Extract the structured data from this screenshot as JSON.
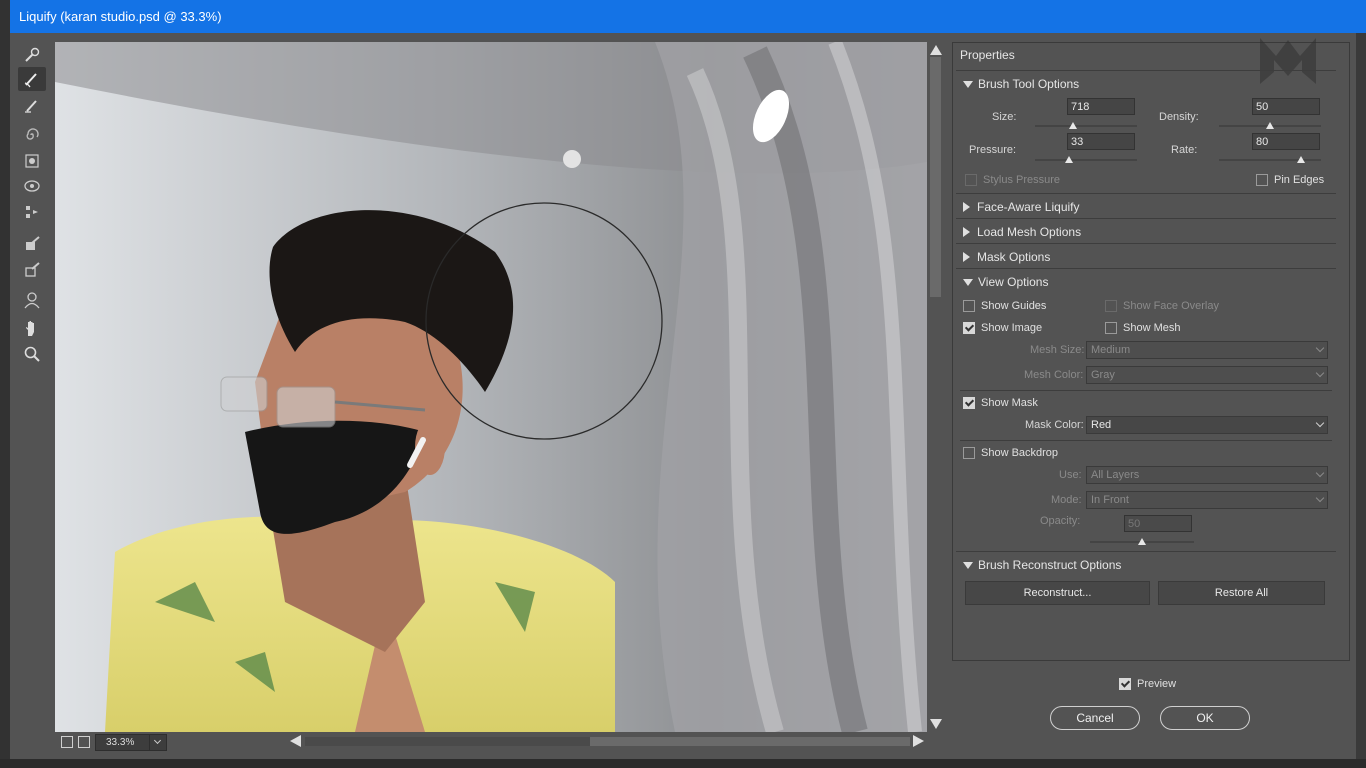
{
  "window": {
    "title": "Liquify (karan studio.psd @ 33.3%)"
  },
  "toolbar": {
    "tools": [
      "forward-warp",
      "reconstruct",
      "smooth",
      "twirl",
      "pucker",
      "bloat",
      "push-left",
      "freeze-mask",
      "thaw-mask",
      "face",
      "hand",
      "zoom"
    ]
  },
  "canvas": {
    "zoom": "33.3%"
  },
  "properties": {
    "title": "Properties",
    "brush_tool_options": {
      "heading": "Brush Tool Options",
      "size_label": "Size:",
      "size_value": "718",
      "size_level": 0.37,
      "density_label": "Density:",
      "density_value": "50",
      "density_level": 0.5,
      "pressure_label": "Pressure:",
      "pressure_value": "33",
      "pressure_level": 0.33,
      "rate_label": "Rate:",
      "rate_value": "80",
      "rate_level": 0.8,
      "stylus_pressure": "Stylus Pressure",
      "pin_edges": "Pin Edges"
    },
    "face_aware": "Face-Aware Liquify",
    "load_mesh": "Load Mesh Options",
    "mask_options": "Mask Options",
    "view_options": {
      "heading": "View Options",
      "show_guides": "Show Guides",
      "show_face_overlay": "Show Face Overlay",
      "show_image": "Show Image",
      "show_mesh": "Show Mesh",
      "mesh_size_label": "Mesh Size:",
      "mesh_size_value": "Medium",
      "mesh_color_label": "Mesh Color:",
      "mesh_color_value": "Gray",
      "show_mask": "Show Mask",
      "mask_color_label": "Mask Color:",
      "mask_color_value": "Red",
      "show_backdrop": "Show Backdrop",
      "use_label": "Use:",
      "use_value": "All Layers",
      "mode_label": "Mode:",
      "mode_value": "In Front",
      "opacity_label": "Opacity:",
      "opacity_value": "50",
      "opacity_level": 0.5
    },
    "brush_reconstruct": {
      "heading": "Brush Reconstruct Options",
      "reconstruct": "Reconstruct...",
      "restore_all": "Restore All"
    }
  },
  "footer": {
    "preview": "Preview",
    "cancel": "Cancel",
    "ok": "OK"
  },
  "colors": {
    "title_bar": "#1473e6",
    "panel": "#535353"
  }
}
